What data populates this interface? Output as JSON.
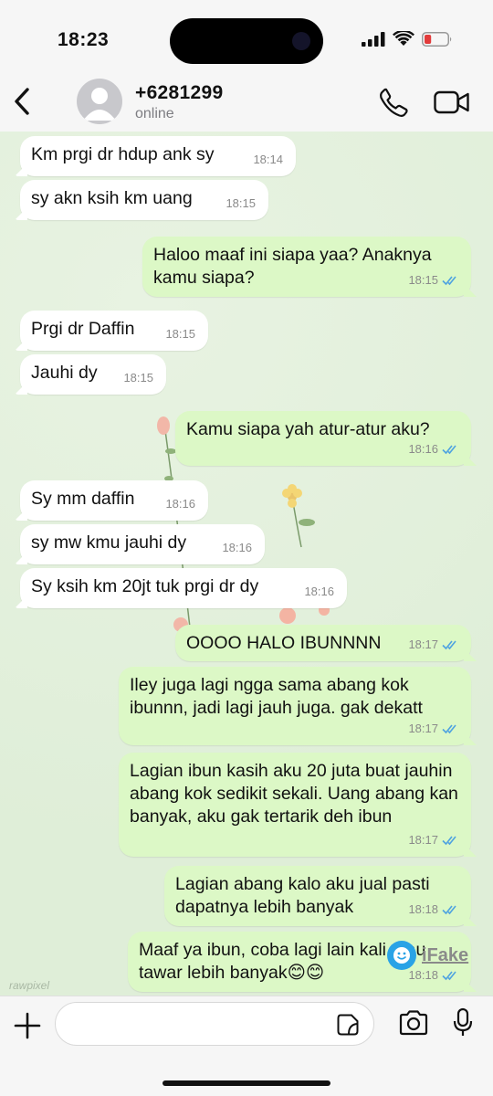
{
  "status_bar": {
    "time": "18:23",
    "battery_level": 0.3
  },
  "header": {
    "contact_name": "+6281299",
    "contact_status": "online",
    "icons": [
      "back-chevron-icon",
      "avatar-placeholder-icon",
      "phone-icon",
      "video-camera-icon"
    ]
  },
  "messages": [
    {
      "dir": "in",
      "text": "Km prgi dr hdup ank sy",
      "time": "18:14"
    },
    {
      "dir": "in",
      "text": "sy akn ksih km uang",
      "time": "18:15"
    },
    {
      "dir": "out",
      "text": "Haloo maaf ini siapa yaa? Anaknya kamu siapa?",
      "time": "18:15"
    },
    {
      "dir": "in",
      "text": "Prgi dr Daffin",
      "time": "18:15"
    },
    {
      "dir": "in",
      "text": "Jauhi dy",
      "time": "18:15"
    },
    {
      "dir": "out",
      "text": "Kamu siapa yah atur-atur aku?",
      "time": "18:16"
    },
    {
      "dir": "in",
      "text": "Sy mm daffin",
      "time": "18:16"
    },
    {
      "dir": "in",
      "text": "sy mw kmu jauhi dy",
      "time": "18:16"
    },
    {
      "dir": "in",
      "text": "Sy ksih km 20jt tuk prgi dr dy",
      "time": "18:16"
    },
    {
      "dir": "out",
      "text": "OOOO HALO IBUNNNN",
      "time": "18:17"
    },
    {
      "dir": "out",
      "text": "Iley juga lagi ngga sama abang kok ibunnn, jadi lagi jauh juga. gak dekatt",
      "time": "18:17"
    },
    {
      "dir": "out",
      "text": "Lagian ibun kasih aku 20 juta buat jauhin abang kok sedikit sekali. Uang abang kan banyak, aku gak tertarik deh ibun",
      "time": "18:17"
    },
    {
      "dir": "out",
      "text": "Lagian abang kalo aku jual pasti dapatnya lebih banyak",
      "time": "18:18"
    },
    {
      "dir": "out",
      "text": "Maaf ya ibun, coba lagi lain kali atau tawar lebih banyak😊😊",
      "time": "18:18"
    }
  ],
  "watermarks": {
    "rawpixel": "rawpixel",
    "ifake": "iFake"
  },
  "input": {
    "placeholder": "",
    "value": ""
  },
  "colors": {
    "outgoing_bubble": "#dcf8c6",
    "incoming_bubble": "#ffffff",
    "chat_background": "#e3f0dc",
    "tick_blue": "#4fa3e0"
  }
}
